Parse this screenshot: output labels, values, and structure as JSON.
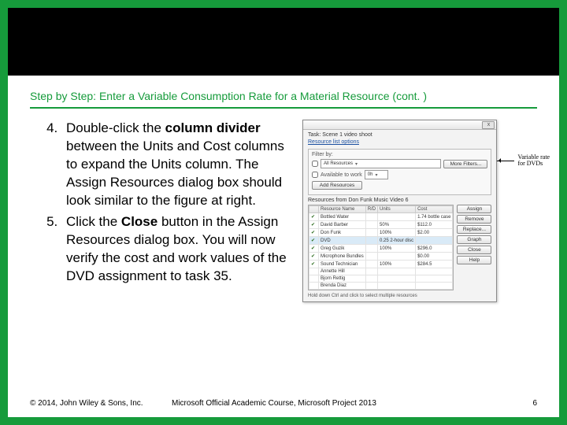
{
  "title": "Step by Step: Enter a Variable Consumption Rate for a Material Resource (cont. )",
  "steps": {
    "s4_a": "Double-click the ",
    "s4_b": "column divider",
    "s4_c": " between the Units and Cost columns to expand the Units column. The Assign Resources dialog box should look similar to the figure at right.",
    "s5_a": "Click the ",
    "s5_b": "Close",
    "s5_c": " button in the Assign Resources dialog box. You will now verify the cost and work values of the DVD assignment to task 35."
  },
  "dialog": {
    "task_label": "Task: Scene 1 video shoot",
    "link": "Resource list options",
    "filter_heading": "Filter by:",
    "all_res": "All Resources",
    "more_filters": "More Filters...",
    "avail_label": "Available to work",
    "avail_value": "0h",
    "add_btn": "Add Resources",
    "from_label": "Resources from Don Funk Music Video 6",
    "cols": {
      "rn": "Resource Name",
      "rd": "R/D",
      "units": "Units",
      "cost": "Cost"
    },
    "rows": [
      {
        "chk": true,
        "name": "Bottled Water",
        "units": "",
        "cost": "1.74 bottle case"
      },
      {
        "chk": true,
        "name": "David Barber",
        "units": "50%",
        "cost": "$112.0"
      },
      {
        "chk": true,
        "name": "Don Funk",
        "units": "100%",
        "cost": "$2.00"
      },
      {
        "chk": true,
        "name": "DVD",
        "units": "0.25 2-hour disc",
        "cost": "",
        "hl": true
      },
      {
        "chk": true,
        "name": "Greg Guzik",
        "units": "100%",
        "cost": "$296.0"
      },
      {
        "chk": true,
        "name": "Microphone Bundles",
        "units": "",
        "cost": "$0.00"
      },
      {
        "chk": true,
        "name": "Sound Technician",
        "units": "100%",
        "cost": "$284.5"
      },
      {
        "chk": false,
        "name": "Annette Hill",
        "units": "",
        "cost": ""
      },
      {
        "chk": false,
        "name": "Bjorn Rettig",
        "units": "",
        "cost": ""
      },
      {
        "chk": false,
        "name": "Brenda Diaz",
        "units": "",
        "cost": ""
      }
    ],
    "buttons": {
      "assign": "Assign",
      "remove": "Remove",
      "replace": "Replace...",
      "graph": "Graph",
      "close": "Close",
      "help": "Help"
    },
    "foot": "Hold down Ctrl and click to select multiple resources"
  },
  "callout": "Variable rate for DVDs",
  "footer": {
    "copyright": "© 2014, John Wiley & Sons, Inc.",
    "course": "Microsoft Official Academic Course, Microsoft Project 2013",
    "page": "6"
  }
}
